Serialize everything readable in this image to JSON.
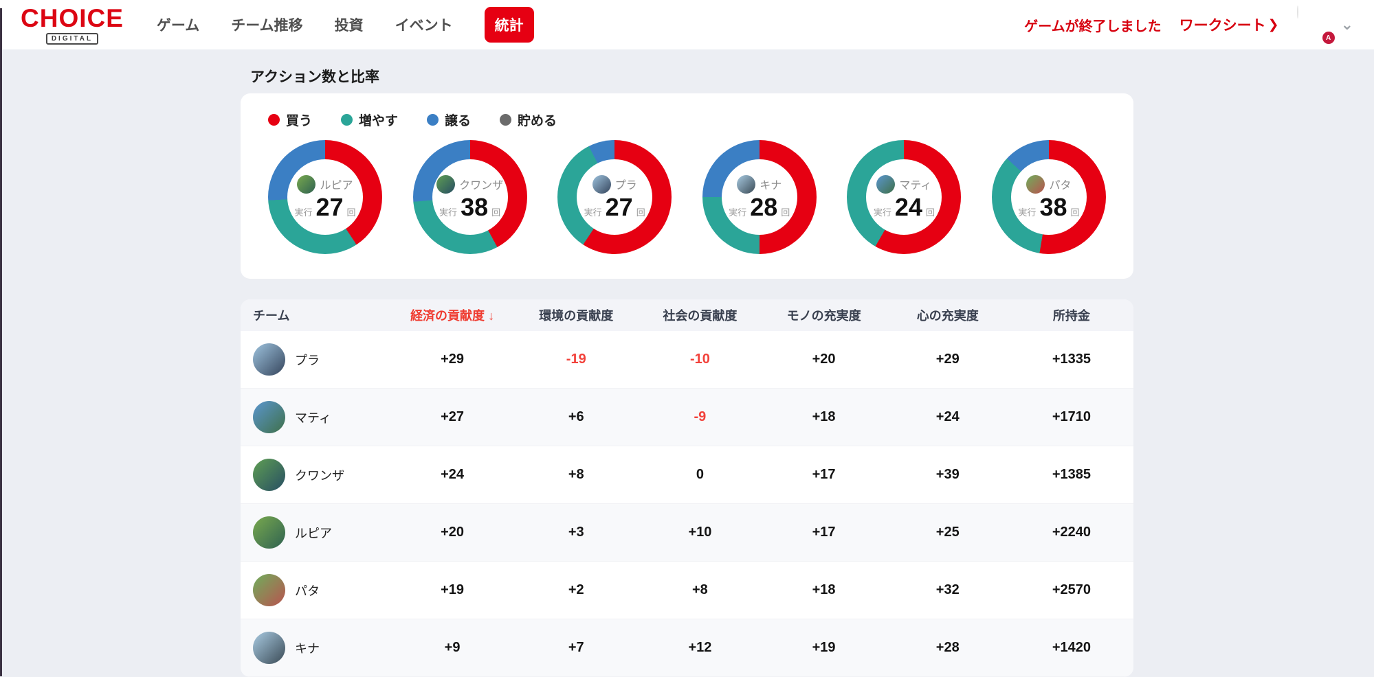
{
  "topbar": {
    "logo": {
      "title": "CHOICE",
      "subtitle": "DIGITAL"
    },
    "nav": [
      {
        "label": "ゲーム",
        "active": false
      },
      {
        "label": "チーム推移",
        "active": false
      },
      {
        "label": "投資",
        "active": false
      },
      {
        "label": "イベント",
        "active": false
      },
      {
        "label": "統計",
        "active": true
      }
    ],
    "status_message": "ゲームが終了しました",
    "worksheet_link": "ワークシート",
    "worksheet_arrow": "❯",
    "account_badge": "A"
  },
  "section": {
    "title": "アクション数と比率"
  },
  "colors": {
    "buy": "#e60012",
    "grow": "#2ba598",
    "give": "#3b7fc4",
    "save": "#6b6b6b",
    "negative": "#f2423b",
    "accent_red": "#d7000f"
  },
  "legend": [
    {
      "label": "買う",
      "color_key": "buy"
    },
    {
      "label": "増やす",
      "color_key": "grow"
    },
    {
      "label": "譲る",
      "color_key": "give"
    },
    {
      "label": "貯める",
      "color_key": "save"
    }
  ],
  "donut_labels": {
    "prefix": "実行",
    "suffix": "回"
  },
  "chart_data": {
    "type": "pie",
    "title": "アクション数と比率",
    "note": "6 donut charts, one per team; segments clockwise from top in order 買う(red), 増やす(teal), 譲る(blue), 貯める(gray); center shows 実行 total 回",
    "teams": [
      {
        "name": "ルピア",
        "total": 27,
        "segments": {
          "買う": 11,
          "増やす": 9,
          "譲る": 7,
          "貯める": 0
        },
        "avatar_colors": [
          "#79a94e",
          "#2f6251"
        ]
      },
      {
        "name": "クワンザ",
        "total": 38,
        "segments": {
          "買う": 16,
          "増やす": 12,
          "譲る": 10,
          "貯める": 0
        },
        "avatar_colors": [
          "#5f9e53",
          "#274e63"
        ]
      },
      {
        "name": "プラ",
        "total": 27,
        "segments": {
          "買う": 16,
          "増やす": 9,
          "譲る": 2,
          "貯める": 0
        },
        "avatar_colors": [
          "#9ec3de",
          "#35455c"
        ]
      },
      {
        "name": "キナ",
        "total": 28,
        "segments": {
          "買う": 14,
          "増やす": 7,
          "譲る": 7,
          "貯める": 0
        },
        "avatar_colors": [
          "#a9cbe2",
          "#3a4a55"
        ]
      },
      {
        "name": "マティ",
        "total": 24,
        "segments": {
          "買う": 14,
          "増やす": 10,
          "譲る": 0,
          "貯める": 0
        },
        "avatar_colors": [
          "#5b96cf",
          "#3f7049"
        ]
      },
      {
        "name": "パタ",
        "total": 38,
        "segments": {
          "買う": 20,
          "増やす": 13,
          "譲る": 5,
          "貯める": 0
        },
        "avatar_colors": [
          "#6fae5c",
          "#b9534f"
        ]
      }
    ]
  },
  "table": {
    "columns": [
      {
        "label": "チーム",
        "sorted": false
      },
      {
        "label": "経済の貢献度",
        "sorted": true,
        "sort_arrow": "↓"
      },
      {
        "label": "環境の貢献度",
        "sorted": false
      },
      {
        "label": "社会の貢献度",
        "sorted": false
      },
      {
        "label": "モノの充実度",
        "sorted": false
      },
      {
        "label": "心の充実度",
        "sorted": false
      },
      {
        "label": "所持金",
        "sorted": false
      }
    ],
    "rows": [
      {
        "team": "プラ",
        "values": [
          "+29",
          "-19",
          "-10",
          "+20",
          "+29",
          "+1335"
        ]
      },
      {
        "team": "マティ",
        "values": [
          "+27",
          "+6",
          "-9",
          "+18",
          "+24",
          "+1710"
        ]
      },
      {
        "team": "クワンザ",
        "values": [
          "+24",
          "+8",
          "0",
          "+17",
          "+39",
          "+1385"
        ]
      },
      {
        "team": "ルピア",
        "values": [
          "+20",
          "+3",
          "+10",
          "+17",
          "+25",
          "+2240"
        ]
      },
      {
        "team": "パタ",
        "values": [
          "+19",
          "+2",
          "+8",
          "+18",
          "+32",
          "+2570"
        ]
      },
      {
        "team": "キナ",
        "values": [
          "+9",
          "+7",
          "+12",
          "+19",
          "+28",
          "+1420"
        ]
      }
    ]
  }
}
